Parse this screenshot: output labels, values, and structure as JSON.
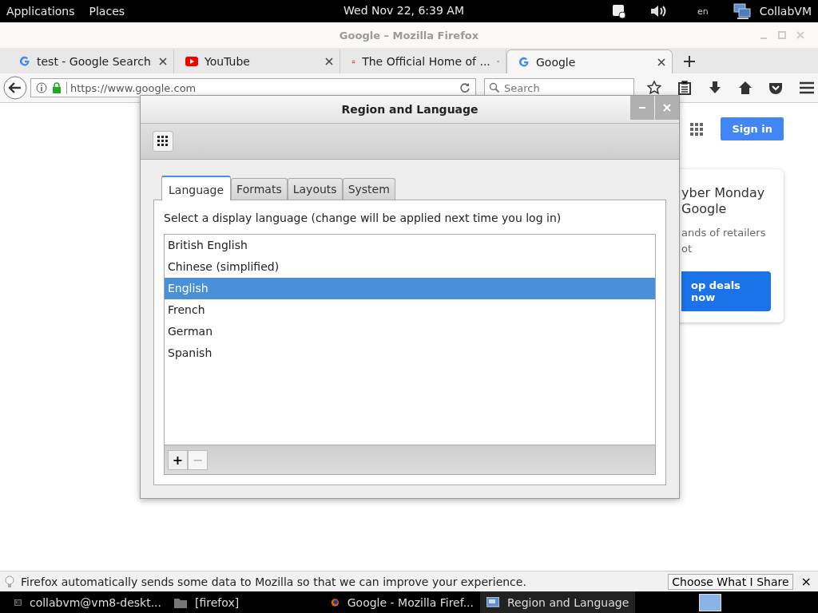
{
  "top_bar": {
    "menus": [
      "Applications",
      "Places"
    ],
    "clock": "Wed Nov 22,  6:39 AM",
    "input_source": "en",
    "user": "CollabVM"
  },
  "firefox": {
    "title": "Google – Mozilla Firefox",
    "tabs": [
      {
        "label": "test - Google Search",
        "selected": false
      },
      {
        "label": "YouTube",
        "selected": false
      },
      {
        "label": "The Official Home of ...",
        "selected": false
      },
      {
        "label": "Google",
        "selected": true
      }
    ],
    "url": "https://www.google.com",
    "search": {
      "placeholder": "Search"
    },
    "page": {
      "sign_in": "Sign in",
      "card": {
        "title_lines": [
          "yber Monday",
          "Google"
        ],
        "body_lines": [
          "ands of retailers",
          "ot"
        ],
        "button": "op deals now"
      }
    },
    "notification": {
      "text": "Firefox automatically sends some data to Mozilla so that we can improve your experience.",
      "button": "Choose What I Share",
      "close": "×"
    }
  },
  "dialog": {
    "title": "Region and Language",
    "tabs": [
      {
        "label": "Language",
        "selected": true
      },
      {
        "label": "Formats",
        "selected": false
      },
      {
        "label": "Layouts",
        "selected": false
      },
      {
        "label": "System",
        "selected": false
      }
    ],
    "instruction": "Select a display language (change will be applied next time you log in)",
    "languages": [
      {
        "name": "British English",
        "selected": false
      },
      {
        "name": "Chinese (simplified)",
        "selected": false
      },
      {
        "name": "English",
        "selected": true
      },
      {
        "name": "French",
        "selected": false
      },
      {
        "name": "German",
        "selected": false
      },
      {
        "name": "Spanish",
        "selected": false
      }
    ],
    "add": "+",
    "remove": "−"
  },
  "taskbar": [
    {
      "label": "collabvm@vm8-deskt...",
      "selected": false
    },
    {
      "label": "[firefox]",
      "selected": false
    },
    {
      "label": "Google - Mozilla Firef...",
      "selected": false
    },
    {
      "label": "Region and Language",
      "selected": true
    }
  ]
}
